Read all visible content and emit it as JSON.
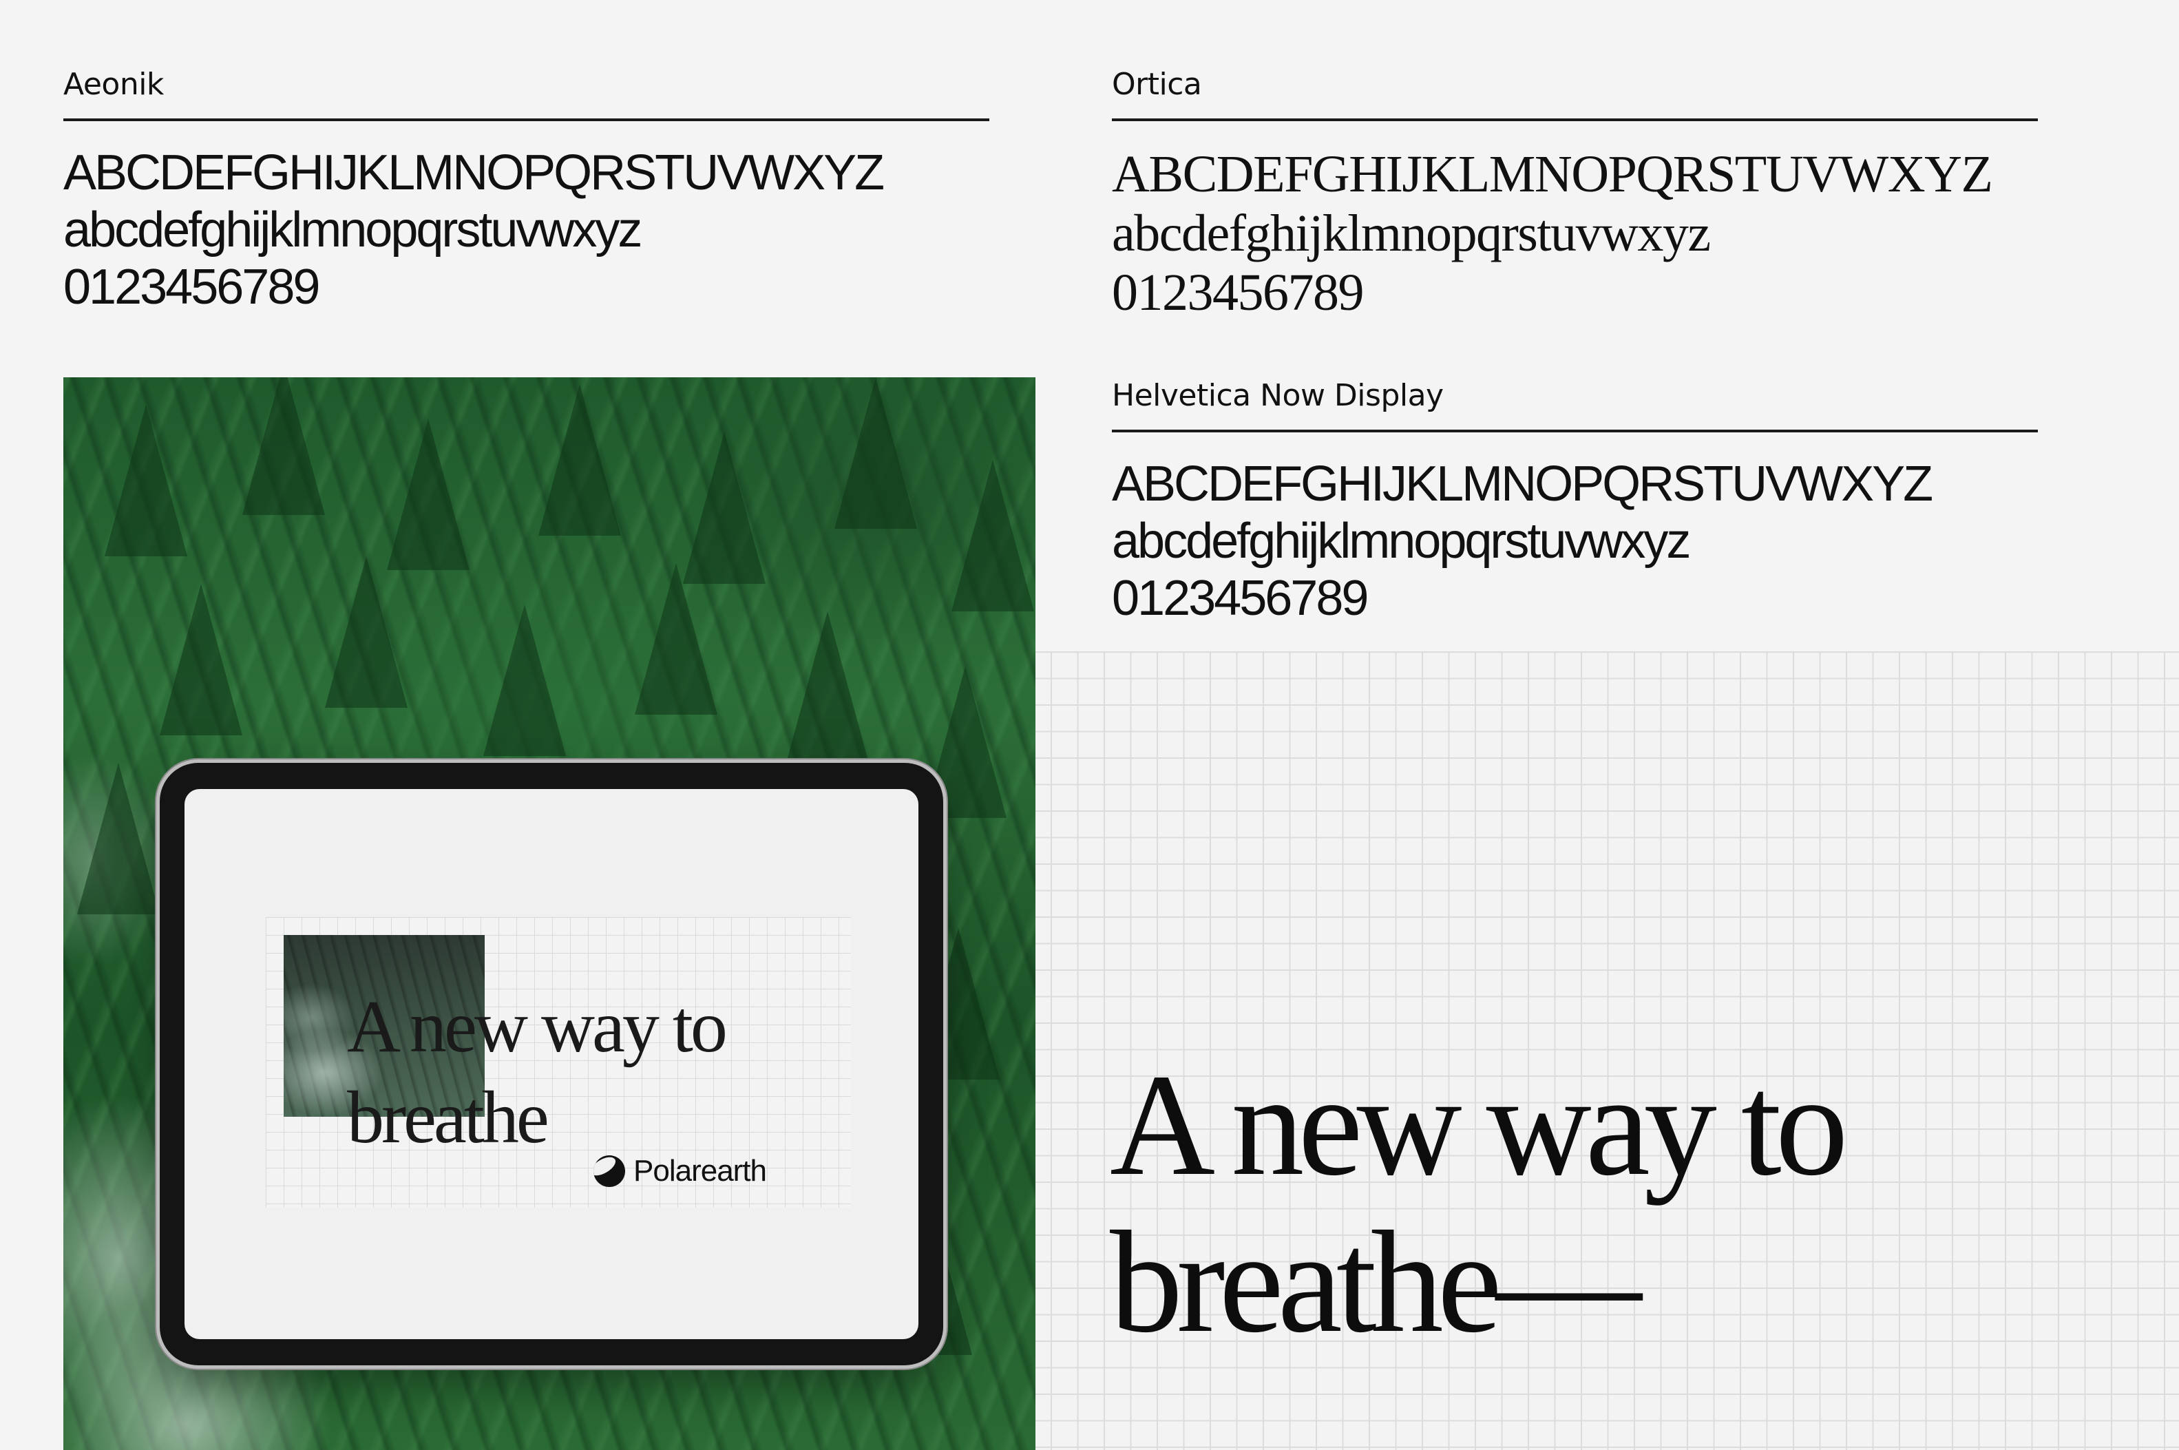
{
  "specimens": {
    "aeonik": {
      "name": "Aeonik",
      "uppercase": "ABCDEFGHIJKLMNOPQRSTUVWXYZ",
      "lowercase": "abcdefghijklmnopqrstuvwxyz",
      "digits": "0123456789"
    },
    "ortica": {
      "name": "Ortica",
      "uppercase": "ABCDEFGHIJKLMNOPQRSTUVWXYZ",
      "lowercase": "abcdefghijklmnopqrstuvwxyz",
      "digits": "0123456789"
    },
    "helvetica": {
      "name": "Helvetica Now Display",
      "uppercase": "ABCDEFGHIJKLMNOPQRSTUVWXYZ",
      "lowercase": "abcdefghijklmnopqrstuvwxyz",
      "digits": "0123456789"
    }
  },
  "tablet": {
    "headline_line1": "A new way to",
    "headline_line2": "breathe",
    "brand_icon": "polarearth-logo-icon",
    "brand_name": "Polarearth"
  },
  "hero": {
    "headline_line1": "A new way to",
    "headline_line2": "breathe—"
  },
  "colors": {
    "background": "#f4f4f4",
    "forest_green": "#2c6e38",
    "text": "#111111",
    "grid_line": "#dcdcdc"
  }
}
